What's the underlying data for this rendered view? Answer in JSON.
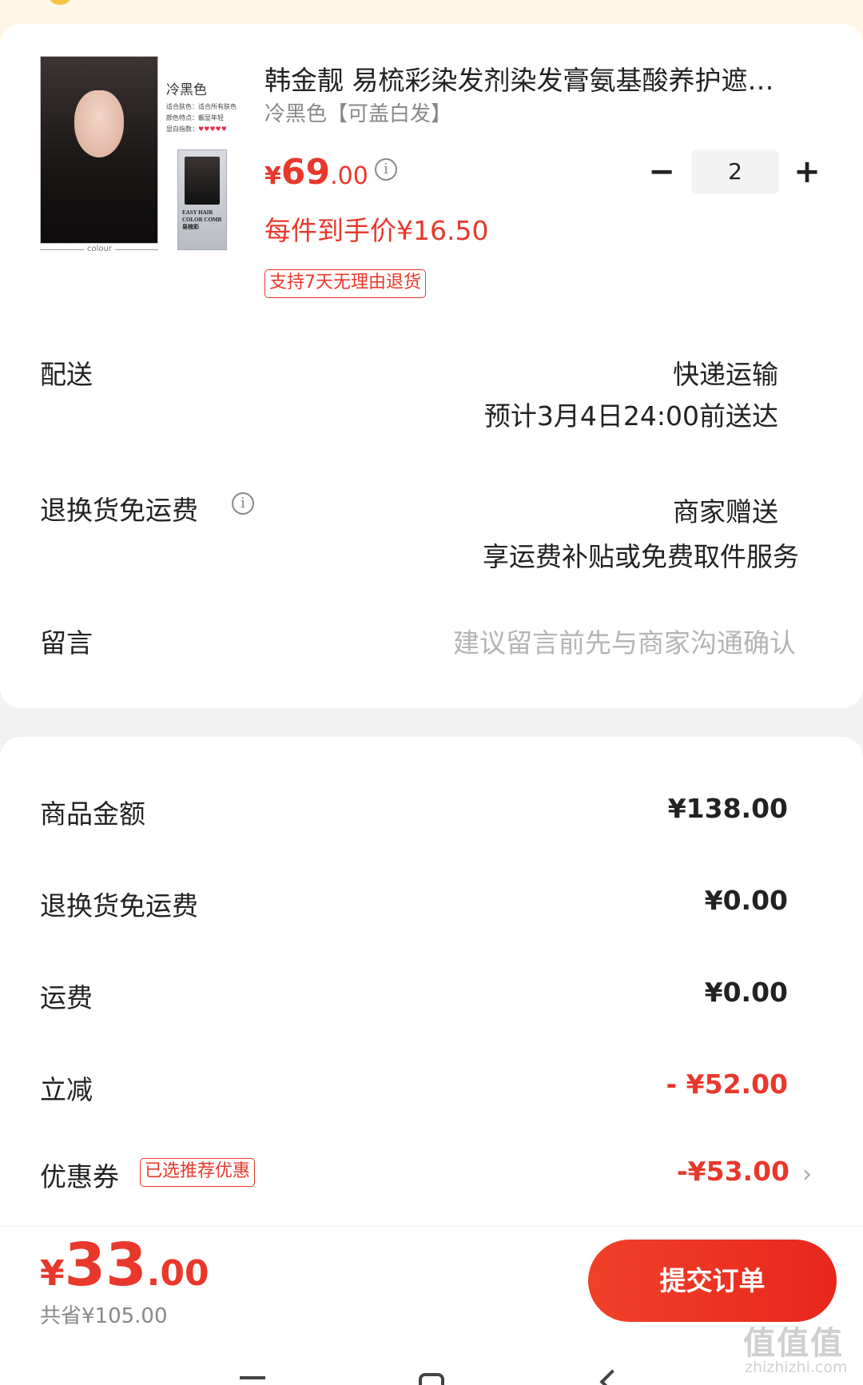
{
  "product": {
    "title": "韩金靓 易梳彩染发剂染发膏氨基酸养护遮…",
    "variant": "冷黑色【可盖白发】",
    "price_currency": "¥",
    "price_int": "69",
    "price_dec": ".00",
    "each_price": "每件到手价¥16.50",
    "return_tag": "支持7天无理由退货",
    "quantity": "2",
    "image": {
      "shade_name": "冷黑色",
      "spec_lines": [
        "适合肤色：适合所有肤色",
        "颜色特点：靓显年轻",
        "显白指数："
      ],
      "hearts": "♥♥♥♥♥",
      "caption": "colour",
      "box_label": "EASY HAIR\nCOLOR COMB\n易梳彩"
    }
  },
  "delivery": {
    "label": "配送",
    "method": "快递运输",
    "eta": "预计3月4日24:00前送达"
  },
  "return_shipping": {
    "label": "退换货免运费",
    "value": "商家赠送",
    "desc": "享运费补贴或免费取件服务"
  },
  "message": {
    "label": "留言",
    "placeholder": "建议留言前先与商家沟通确认"
  },
  "summary": {
    "goods_label": "商品金额",
    "goods_amount": "¥138.00",
    "return_label": "退换货免运费",
    "return_amount": "¥0.00",
    "shipping_label": "运费",
    "shipping_amount": "¥0.00",
    "discount_label": "立减",
    "discount_amount": "- ¥52.00",
    "coupon_label": "优惠券",
    "coupon_tag": "已选推荐优惠",
    "coupon_amount": "-¥53.00"
  },
  "footer": {
    "total_currency": "¥",
    "total_int": "33",
    "total_dec": ".00",
    "saved": "共省¥105.00",
    "submit_label": "提交订单"
  },
  "watermark": {
    "main": "值值值",
    "sub": "zhizhizhi.com"
  },
  "colors": {
    "accent": "#e8382b",
    "muted": "#888888",
    "placeholder": "#b4b4b4"
  }
}
